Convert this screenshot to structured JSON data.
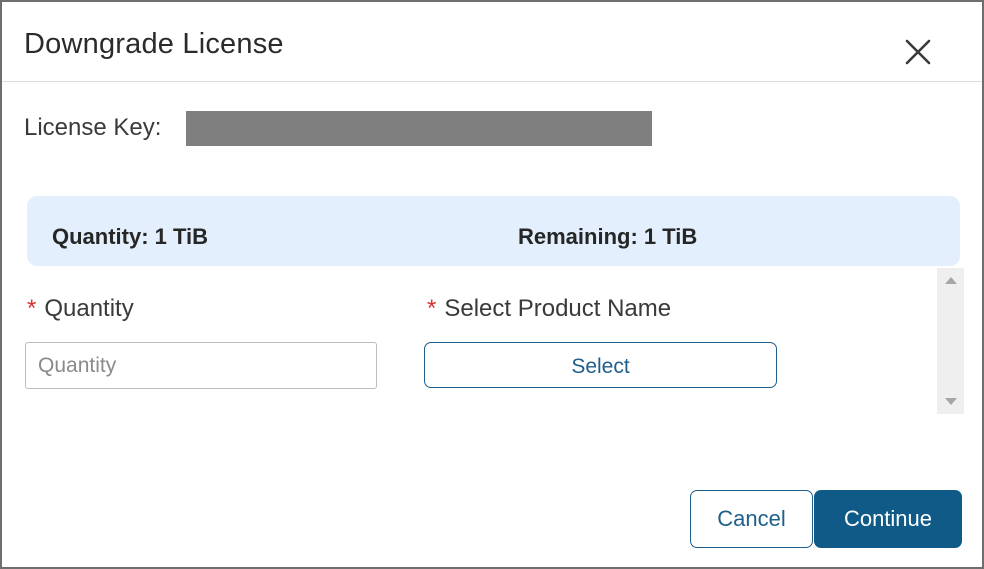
{
  "dialog": {
    "title": "Downgrade License",
    "close_icon": "close-icon"
  },
  "license": {
    "label": "License Key:",
    "value": "",
    "value_redacted": true
  },
  "summary": {
    "quantity_text": "Quantity: 1 TiB",
    "remaining_text": "Remaining: 1 TiB"
  },
  "form": {
    "required_mark": "*",
    "quantity_label": "Quantity",
    "quantity_value": "",
    "quantity_placeholder": "Quantity",
    "product_label": "Select Product Name",
    "product_button_label": "Select"
  },
  "footer": {
    "cancel_label": "Cancel",
    "continue_label": "Continue"
  },
  "colors": {
    "accent": "#0f5a86",
    "outline_accent": "#1f5f8b",
    "summary_bg": "#e3effc",
    "required": "#d9342b",
    "redaction": "#7f7f7f"
  }
}
